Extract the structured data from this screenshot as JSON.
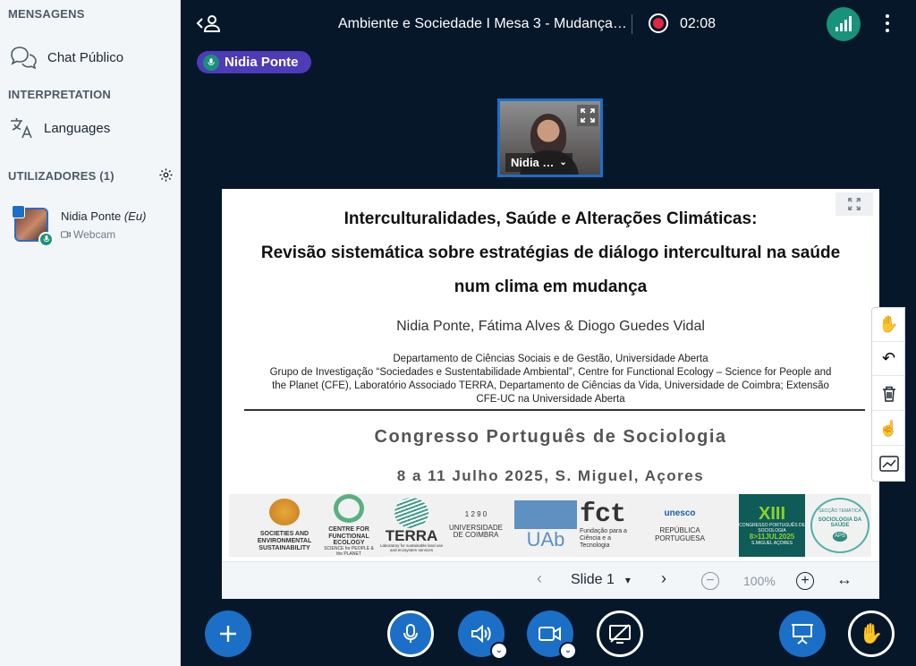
{
  "sidebar": {
    "messages_title": "MENSAGENS",
    "public_chat": "Chat Público",
    "interpretation_title": "INTERPRETATION",
    "languages": "Languages",
    "users_title": "UTILIZADORES (1)",
    "user": {
      "name": "Nidia Ponte",
      "self_tag": "(Eu)",
      "media": "Webcam"
    }
  },
  "topbar": {
    "meeting_title": "Ambiente e Sociedade I Mesa 3 - Mudança…",
    "recording_time": "02:08"
  },
  "speaker_badge": "Nidia Ponte",
  "video": {
    "name": "Nidia …"
  },
  "slide": {
    "title_line1": "Interculturalidades, Saúde e Alterações Climáticas:",
    "title_line2": "Revisão sistemática sobre estratégias de diálogo intercultural na saúde",
    "title_line3": "num clima em mudança",
    "authors": "Nidia Ponte, Fátima Alves & Diogo Guedes Vidal",
    "affil1": "Departamento de Ciências Sociais e de Gestão, Universidade Aberta",
    "affil2": "Grupo de Investigação “Sociedades e Sustentabilidade Ambiental”, Centre for Functional Ecology – Science for People and",
    "affil3": "the Planet (CFE), Laboratório Associado TERRA, Departamento de Ciências da Vida, Universidade de Coimbra; Extensão",
    "affil4": "CFE-UC na Universidade Aberta",
    "congress": "Congresso Português de Sociologia",
    "dates": "8 a 11 Julho 2025, S. Miguel, Açores",
    "logos": {
      "ses": "SOCIETIES AND ENVIRONMENTAL SUSTAINABILITY",
      "cfe": "CENTRE FOR FUNCTIONAL ECOLOGY",
      "cfe_sub": "SCIENCE for PEOPLE & the PLANET",
      "terra": "TERRA",
      "terra_sub": "Laboratory for sustainable land use and ecosystem services",
      "coimbra_year": "1 2 9 0",
      "coimbra": "UNIVERSIDADE DE COIMBRA",
      "uab": "UAb",
      "fct": "fct",
      "fct_sub": "Fundação para a Ciência e a Tecnologia",
      "unesco": "unesco",
      "republica": "REPÚBLICA PORTUGUESA",
      "congress_logo": "CONGRESSO PORTUGUÊS DE SOCIOLOGIA",
      "congress_dates": "8>11JUL2025",
      "congress_place": "S.MIGUEL AÇORES",
      "seccao": "SECÇÃO TEMÁTICA",
      "seccao_name": "SOCIOLOGIA DA SAÚDE",
      "aps": "APS"
    }
  },
  "slide_controls": {
    "slide_label": "Slide 1",
    "zoom": "100%"
  },
  "colors": {
    "background": "#06172a",
    "accent": "#1b6fc7",
    "badge": "#4e3bb8",
    "recording": "#e3253e",
    "connection": "#18927a"
  }
}
